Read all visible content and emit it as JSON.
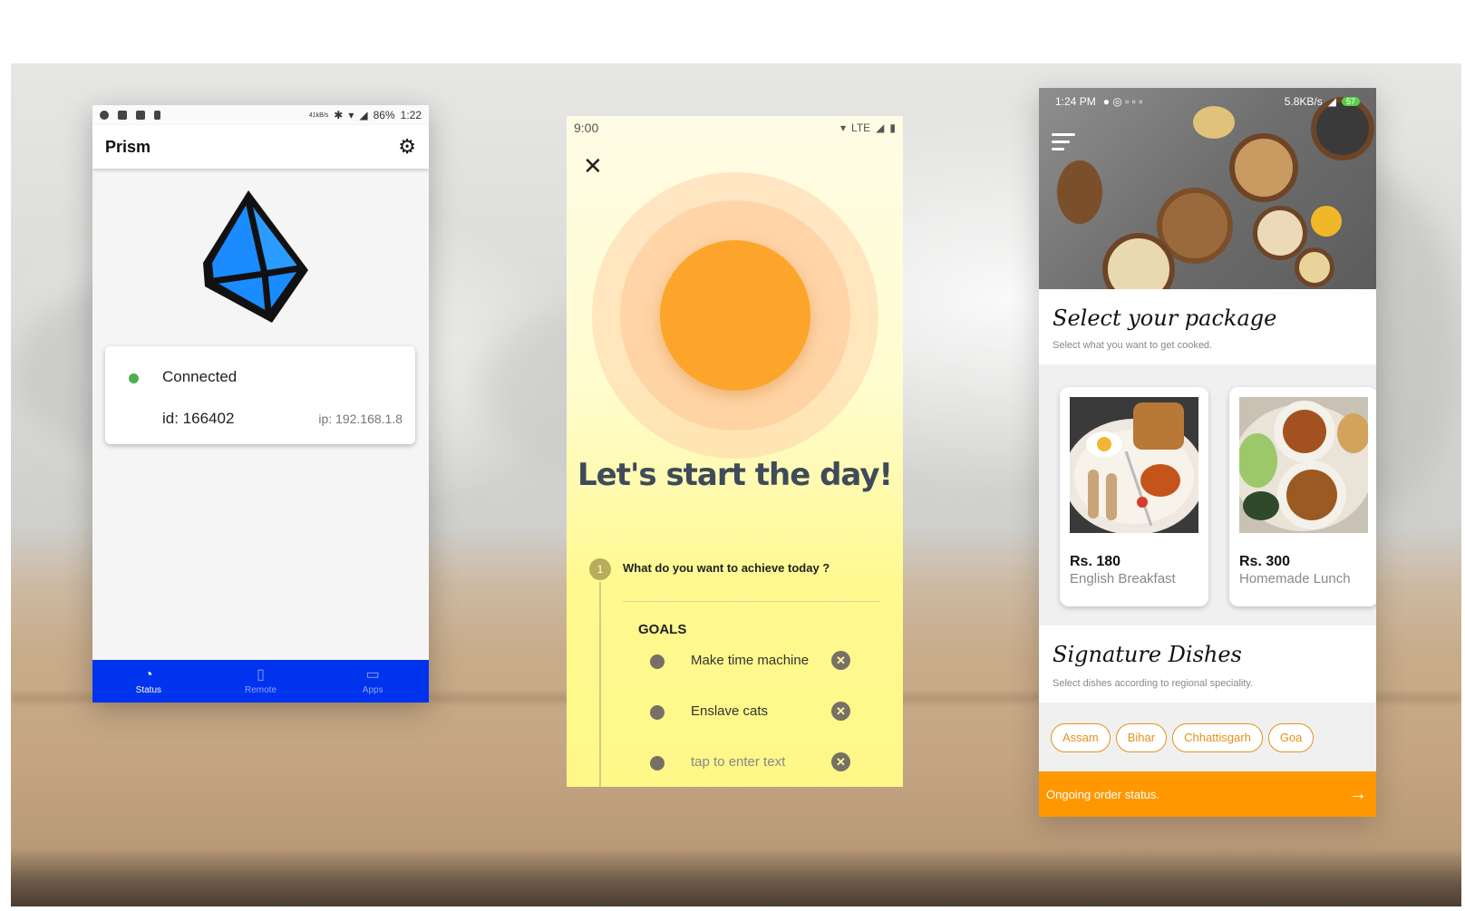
{
  "prism": {
    "status_bar": {
      "net_up": "41kB/s",
      "battery": "86%",
      "time": "1:22"
    },
    "title": "Prism",
    "connection": {
      "status": "Connected",
      "id": "id: 166402",
      "ip": "ip: 192.168.1.8"
    },
    "nav": [
      {
        "label": "Status",
        "icon": "speedometer-icon",
        "active": true
      },
      {
        "label": "Remote",
        "icon": "remote-icon",
        "active": false
      },
      {
        "label": "Apps",
        "icon": "window-icon",
        "active": false
      }
    ],
    "colors": {
      "nav_bg": "#0033ee",
      "connected_dot": "#4caf50",
      "logo": "#1a8cff"
    }
  },
  "day": {
    "status_bar": {
      "time": "9:00",
      "network": "LTE"
    },
    "headline": "Let's start the day!",
    "step": {
      "number": "1",
      "question": "What do you want to achieve today ?"
    },
    "goals_title": "GOALS",
    "goals": [
      {
        "text": "Make time machine",
        "placeholder": false
      },
      {
        "text": "Enslave cats",
        "placeholder": false
      },
      {
        "text": "tap to enter text",
        "placeholder": true
      }
    ],
    "colors": {
      "sun": "#fca52a",
      "background_bottom": "#fff788"
    }
  },
  "food": {
    "status_bar": {
      "time": "1:24 PM",
      "speed": "5.8KB/s",
      "battery": "57"
    },
    "package_section": {
      "title": "Select your package",
      "subtitle": "Select what you want to get cooked."
    },
    "packages": [
      {
        "price": "Rs. 180",
        "name": "English Breakfast"
      },
      {
        "price": "Rs. 300",
        "name": "Homemade Lunch"
      }
    ],
    "dishes_section": {
      "title": "Signature Dishes",
      "subtitle": "Select dishes according to regional speciality."
    },
    "regions": [
      "Assam",
      "Bihar",
      "Chhattisgarh",
      "Goa"
    ],
    "order_bar": {
      "label": "Ongoing order status."
    },
    "colors": {
      "accent": "#ff9800",
      "chip_border": "#e5921a"
    }
  }
}
